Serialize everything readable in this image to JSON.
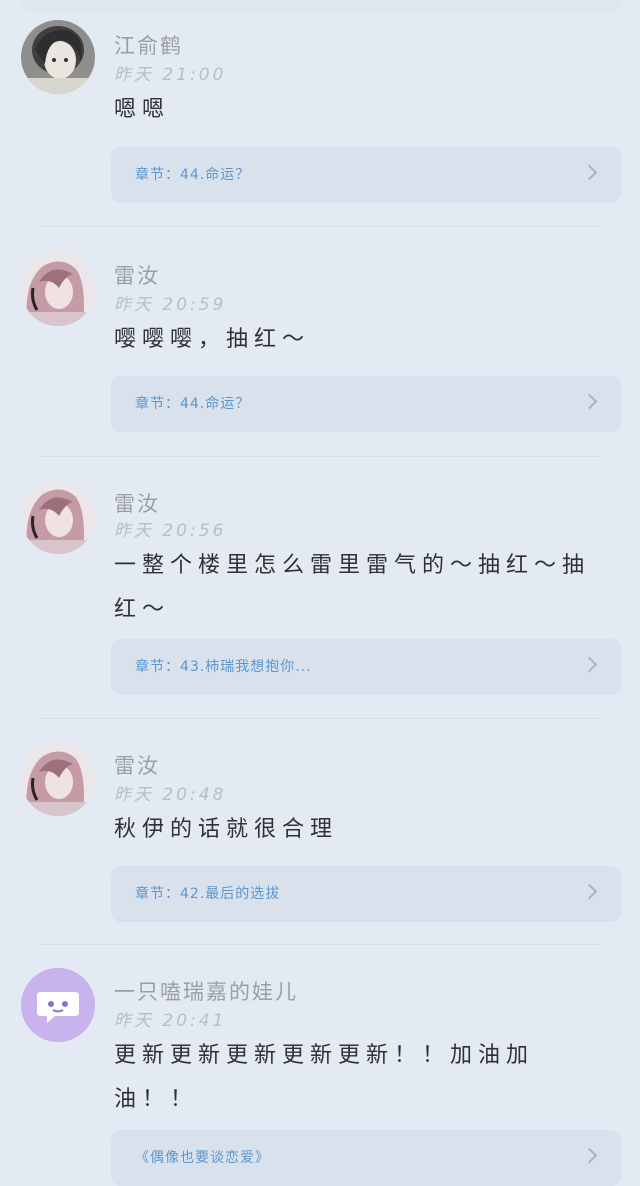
{
  "comments": [
    {
      "name": "江俞鹤",
      "time": "昨天 21:00",
      "text": "嗯嗯",
      "chapter": "章节：44.命运？",
      "avatar": "avatar-boy-portrait"
    },
    {
      "name": "雷汝",
      "time": "昨天 20:59",
      "text": "嘤嘤嘤，抽红～",
      "chapter": "章节：44.命运？",
      "avatar": "avatar-girl-portrait"
    },
    {
      "name": "雷汝",
      "time": "昨天 20:56",
      "text": "一整个楼里怎么雷里雷气的～抽红～抽红～",
      "chapter": "章节：43.柿瑞我想抱你...",
      "avatar": "avatar-girl-portrait"
    },
    {
      "name": "雷汝",
      "time": "昨天 20:48",
      "text": "秋伊的话就很合理",
      "chapter": "章节：42.最后的选拔",
      "avatar": "avatar-girl-portrait"
    },
    {
      "name": "一只嗑瑞嘉的娃儿",
      "time": "昨天 20:41",
      "text": "更新更新更新更新更新！！加油加油！！",
      "chapter": "《偶像也要谈恋爱》",
      "avatar": "chat-bubble-icon"
    }
  ],
  "colors": {
    "background": "#e3eaf3",
    "card": "#d9e1ec",
    "chapter_link": "#5b97cf",
    "avatar_purple": "#c9b3ec"
  }
}
